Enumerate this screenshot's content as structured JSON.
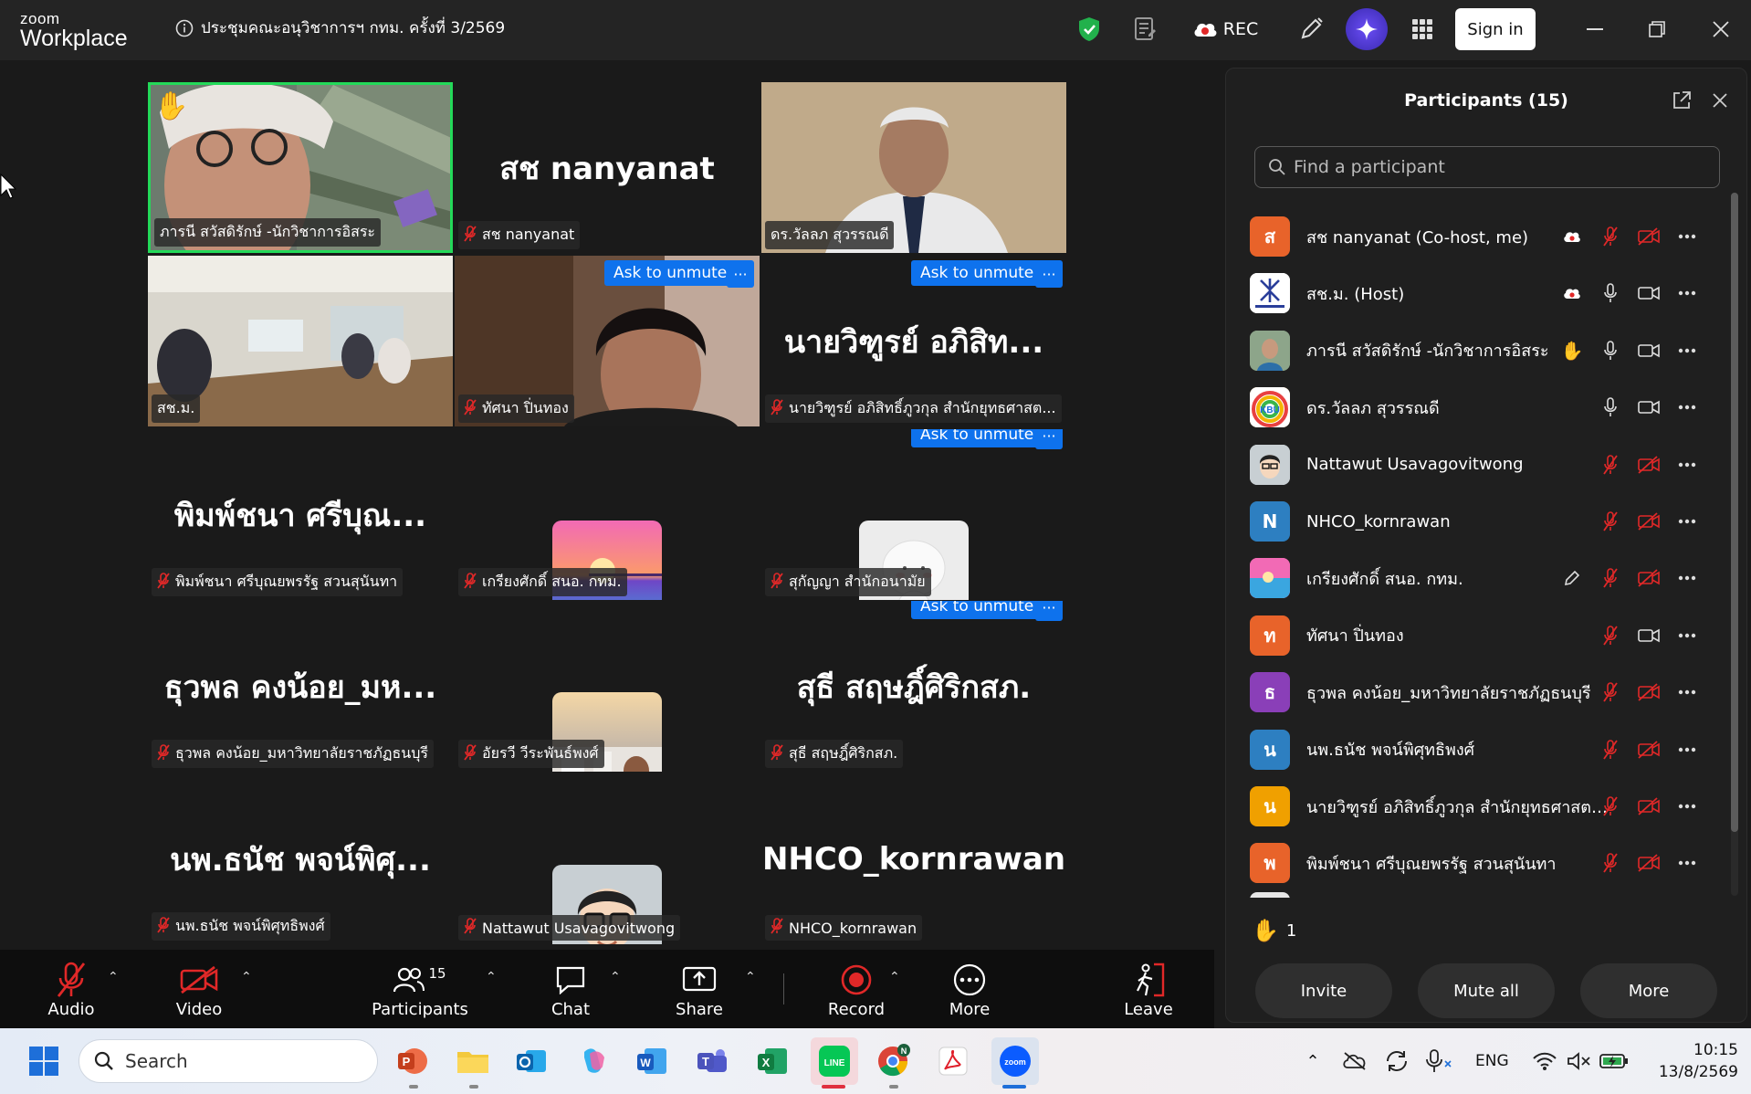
{
  "app": {
    "brand_top": "zoom",
    "brand_bottom": "Workplace"
  },
  "meeting_title": "ประชุมคณะอนุวิชาการฯ กทม. ครั้งที่ 3/2569",
  "titlebar": {
    "rec_label": "REC",
    "signin_label": "Sign in"
  },
  "tiles": [
    {
      "label": "ภารนี สวัสดิรักษ์ -นักวิชาการอิสระ",
      "type": "video",
      "muted": false,
      "hand": true
    },
    {
      "label": "สช nanyanat",
      "big": "สช nanyanat",
      "type": "name",
      "muted": true
    },
    {
      "label": "ดร.วัลลภ สุวรรณดี",
      "type": "video",
      "muted": false
    },
    {
      "label": "สช.ม.",
      "type": "video",
      "muted": false
    },
    {
      "label": "ทัศนา ปิ่นทอง",
      "type": "video",
      "muted": true,
      "ask": "Ask to unmute"
    },
    {
      "label": "นายวิฑูรย์ อภิสิทธิ์ภูวกุล สำนักยุทธศาสต...",
      "big": "นายวิฑูรย์ อภิสิท...",
      "type": "name",
      "muted": true,
      "ask": "Ask to unmute"
    },
    {
      "label": "พิมพ์ชนา ศรีบุณยพรรัฐ สวนสุนันทา",
      "big": "พิมพ์ชนา ศรีบุณ...",
      "type": "name",
      "muted": true
    },
    {
      "label": "เกรียงศักดิ์ สนอ. กทม.",
      "type": "avatar",
      "avatar": "sunset",
      "muted": true
    },
    {
      "label": "สุกัญญา สำนักอนามัย",
      "type": "avatar",
      "avatar": "figure",
      "muted": true,
      "ask": "Ask to unmute"
    },
    {
      "label": "ธุวพล คงน้อย_มหาวิทยาลัยราชภัฏธนบุรี",
      "big": "ธุวพล คงน้อย_มห...",
      "type": "name",
      "muted": true
    },
    {
      "label": "อัยรวี วีระพันธ์พงศ์",
      "type": "avatar",
      "avatar": "travel",
      "muted": true
    },
    {
      "label": "สุธี สฤษฎิ์ศิริกสภ.",
      "big": "สุธี สฤษฎิ์ศิริกสภ.",
      "type": "name",
      "muted": true,
      "ask": "Ask to unmute"
    },
    {
      "label": "นพ.ธนัช พจน์พิศุทธิพงศ์",
      "big": "นพ.ธนัช พจน์พิศุ...",
      "type": "name",
      "muted": true
    },
    {
      "label": "Nattawut Usavagovitwong",
      "type": "avatar",
      "avatar": "cartoon",
      "muted": true
    },
    {
      "label": "NHCO_kornrawan",
      "big": "NHCO_kornrawan",
      "type": "name",
      "muted": true
    }
  ],
  "toolbar": {
    "audio": "Audio",
    "video": "Video",
    "participants": "Participants",
    "participants_count": "15",
    "chat": "Chat",
    "share": "Share",
    "record": "Record",
    "more": "More",
    "leave": "Leave"
  },
  "panel": {
    "title": "Participants (15)",
    "search_placeholder": "Find a participant",
    "participants": [
      {
        "name": "สช nanyanat (Co-host, me)",
        "initial": "ส",
        "color": "#e8632a",
        "cloud": true,
        "mic": "muted",
        "cam": "off"
      },
      {
        "name": "สช.ม. (Host)",
        "initial": "",
        "color": "#ffffff",
        "cloud": true,
        "mic": "on",
        "cam": "on",
        "logo": true
      },
      {
        "name": "ภารนี สวัสดิรักษ์ -นักวิชาการอิสระ",
        "initial": "",
        "color": "#6a8a6a",
        "hand": true,
        "mic": "on",
        "cam": "on",
        "photo": true
      },
      {
        "name": "ดร.วัลลภ สุวรรณดี",
        "initial": "",
        "color": "#f0a040",
        "mic": "on",
        "cam": "on",
        "rainbow": true
      },
      {
        "name": "Nattawut Usavagovitwong",
        "initial": "",
        "color": "#c0c8cc",
        "mic": "muted",
        "cam": "off",
        "cartoon": true
      },
      {
        "name": "NHCO_kornrawan",
        "initial": "N",
        "color": "#2d7fc1",
        "mic": "muted",
        "cam": "off"
      },
      {
        "name": "เกรียงศักดิ์ สนอ. กทม.",
        "initial": "",
        "color": "#e060a0",
        "pen": true,
        "mic": "muted",
        "cam": "off",
        "sunset": true
      },
      {
        "name": "ทัศนา ปิ่นทอง",
        "initial": "ท",
        "color": "#e8632a",
        "mic": "muted",
        "cam": "on"
      },
      {
        "name": "ธุวพล คงน้อย_มหาวิทยาลัยราชภัฏธนบุรี",
        "initial": "ธ",
        "color": "#8a3fb8",
        "mic": "muted",
        "cam": "off"
      },
      {
        "name": "นพ.ธนัช พจน์พิศุทธิพงศ์",
        "initial": "น",
        "color": "#2d7fc1",
        "mic": "muted",
        "cam": "off"
      },
      {
        "name": "นายวิฑูรย์ อภิสิทธิ์ภูวกุล สำนักยุทธศาสตร์...",
        "initial": "น",
        "color": "#f0a000",
        "mic": "muted",
        "cam": "off"
      },
      {
        "name": "พิมพ์ชนา ศรีบุณยพรรัฐ สวนสุนันทา",
        "initial": "พ",
        "color": "#e8632a",
        "mic": "muted",
        "cam": "off"
      }
    ],
    "raised_count": "1",
    "invite": "Invite",
    "mute_all": "Mute all",
    "more": "More"
  },
  "taskbar": {
    "search": "Search",
    "lang": "ENG",
    "time": "10:15",
    "date": "13/8/2569"
  }
}
